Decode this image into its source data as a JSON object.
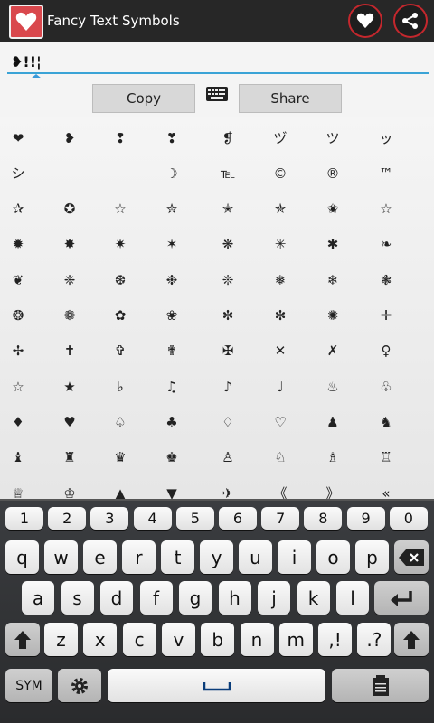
{
  "app": {
    "title": "Fancy Text Symbols",
    "logo_icon": "heart-icon",
    "accent_color": "#c4272d"
  },
  "actions": {
    "favorite_icon": "heart-icon",
    "share_icon": "share-icon"
  },
  "input": {
    "value": "❥!!¦"
  },
  "buttons": {
    "copy_label": "Copy",
    "share_label": "Share",
    "keyboard_icon": "keyboard-icon"
  },
  "symbol_rows": [
    [
      "❤",
      "❥",
      "❢",
      "❣",
      "❡",
      "ヅ",
      "ツ",
      "ッ"
    ],
    [
      "シ",
      "",
      "",
      "☽",
      "℡",
      "©",
      "®",
      "™"
    ],
    [
      "✰",
      "✪",
      "☆",
      "✮",
      "✭",
      "✯",
      "✬",
      "☆"
    ],
    [
      "✹",
      "✸",
      "✷",
      "✶",
      "❋",
      "✳",
      "✱",
      "❧"
    ],
    [
      "❦",
      "❈",
      "❆",
      "❉",
      "❊",
      "❅",
      "❄",
      "❃"
    ],
    [
      "❂",
      "❁",
      "✿",
      "❀",
      "✼",
      "✻",
      "✺",
      "✛"
    ],
    [
      "✢",
      "✝",
      "✞",
      "✟",
      "✠",
      "✕",
      "✗",
      "♀"
    ],
    [
      "☆",
      "★",
      "♭",
      "♫",
      "♪",
      "♩",
      "♨",
      "♧"
    ],
    [
      "♦",
      "♥",
      "♤",
      "♣",
      "♢",
      "♡",
      "♟",
      "♞"
    ],
    [
      "♝",
      "♜",
      "♛",
      "♚",
      "♙",
      "♘",
      "♗",
      "♖"
    ],
    [
      "♕",
      "♔",
      "▲",
      "▼",
      "✈",
      "《",
      "》",
      "«"
    ]
  ],
  "keyboard": {
    "number_row": [
      "1",
      "2",
      "3",
      "4",
      "5",
      "6",
      "7",
      "8",
      "9",
      "0"
    ],
    "row1": [
      "q",
      "w",
      "e",
      "r",
      "t",
      "y",
      "u",
      "i",
      "o",
      "p"
    ],
    "row2": [
      "a",
      "s",
      "d",
      "f",
      "g",
      "h",
      "j",
      "k",
      "l"
    ],
    "row3": [
      "z",
      "x",
      "c",
      "v",
      "b",
      "n",
      "m",
      ",!",
      ".?"
    ],
    "sym_label": "SYM",
    "backspace_icon": "backspace-icon",
    "enter_icon": "enter-icon",
    "shift_icon": "shift-icon",
    "settings_icon": "gear-icon",
    "space_icon": "space-icon",
    "clipboard_icon": "clipboard-icon"
  }
}
